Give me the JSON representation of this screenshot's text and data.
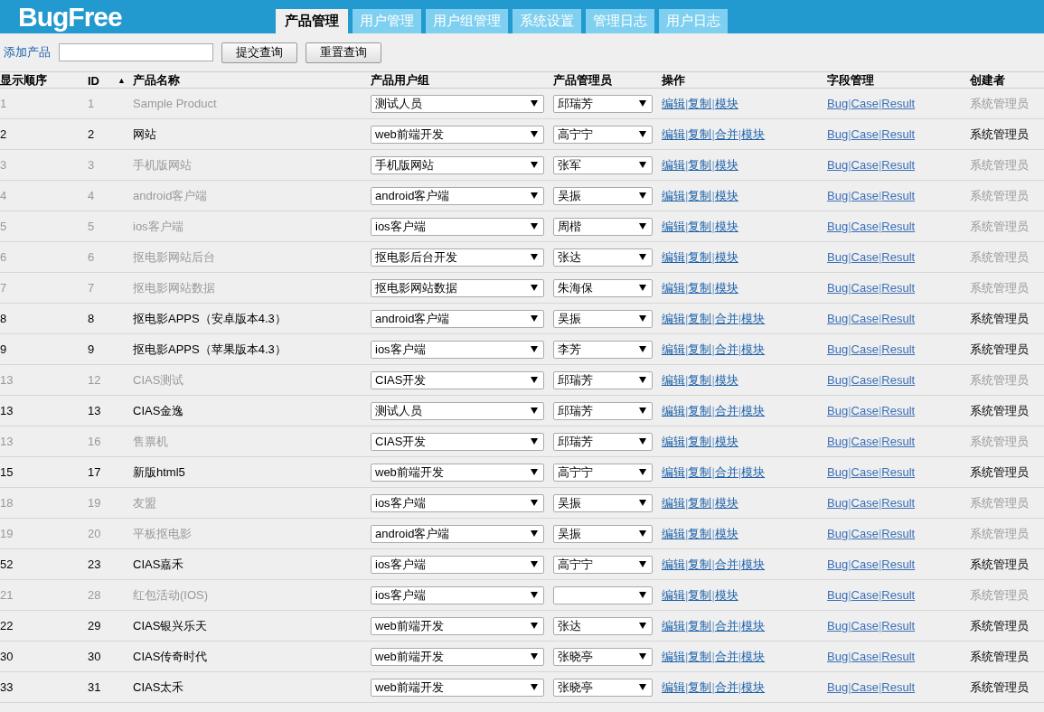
{
  "header": {
    "logo": "BugFree",
    "tabs": [
      {
        "label": "产品管理",
        "selected": true
      },
      {
        "label": "用户管理",
        "selected": false
      },
      {
        "label": "用户组管理",
        "selected": false
      },
      {
        "label": "系统设置",
        "selected": false
      },
      {
        "label": "管理日志",
        "selected": false
      },
      {
        "label": "用户日志",
        "selected": false
      }
    ]
  },
  "toolbar": {
    "add_link": "添加产品",
    "buttons": [
      "提交查询",
      "重置查询"
    ]
  },
  "separator": "|",
  "table": {
    "columns": [
      {
        "label": "显示顺序"
      },
      {
        "label": "ID",
        "sort_indicator": "▲"
      },
      {
        "label": "产品名称"
      },
      {
        "label": "产品用户组"
      },
      {
        "label": "产品管理员"
      },
      {
        "label": "操作"
      },
      {
        "label": "字段管理"
      },
      {
        "label": "创建者"
      }
    ],
    "rows": [
      {
        "order": "1",
        "id": "1",
        "name": "Sample Product",
        "group": "测试人员",
        "manager": "邱瑞芳",
        "actions": [
          "编辑",
          "复制",
          "模块"
        ],
        "fields": [
          "Bug",
          "Case",
          "Result"
        ],
        "creator": "系统管理员",
        "disabled": true
      },
      {
        "order": "2",
        "id": "2",
        "name": "网站",
        "group": "web前端开发",
        "manager": "高宁宁",
        "actions": [
          "编辑",
          "复制",
          "合并",
          "模块"
        ],
        "fields": [
          "Bug",
          "Case",
          "Result"
        ],
        "creator": "系统管理员",
        "disabled": false
      },
      {
        "order": "3",
        "id": "3",
        "name": "手机版网站",
        "group": "手机版网站",
        "manager": "张军",
        "actions": [
          "编辑",
          "复制",
          "模块"
        ],
        "fields": [
          "Bug",
          "Case",
          "Result"
        ],
        "creator": "系统管理员",
        "disabled": true
      },
      {
        "order": "4",
        "id": "4",
        "name": "android客户端",
        "group": "android客户端",
        "manager": "吴振",
        "actions": [
          "编辑",
          "复制",
          "模块"
        ],
        "fields": [
          "Bug",
          "Case",
          "Result"
        ],
        "creator": "系统管理员",
        "disabled": true
      },
      {
        "order": "5",
        "id": "5",
        "name": "ios客户端",
        "group": "ios客户端",
        "manager": "周楷",
        "actions": [
          "编辑",
          "复制",
          "模块"
        ],
        "fields": [
          "Bug",
          "Case",
          "Result"
        ],
        "creator": "系统管理员",
        "disabled": true
      },
      {
        "order": "6",
        "id": "6",
        "name": "抠电影网站后台",
        "group": "抠电影后台开发",
        "manager": "张达",
        "actions": [
          "编辑",
          "复制",
          "模块"
        ],
        "fields": [
          "Bug",
          "Case",
          "Result"
        ],
        "creator": "系统管理员",
        "disabled": true
      },
      {
        "order": "7",
        "id": "7",
        "name": "抠电影网站数据",
        "group": "抠电影网站数据",
        "manager": "朱海保",
        "actions": [
          "编辑",
          "复制",
          "模块"
        ],
        "fields": [
          "Bug",
          "Case",
          "Result"
        ],
        "creator": "系统管理员",
        "disabled": true
      },
      {
        "order": "8",
        "id": "8",
        "name": "抠电影APPS（安卓版本4.3）",
        "group": "android客户端",
        "manager": "吴振",
        "actions": [
          "编辑",
          "复制",
          "合并",
          "模块"
        ],
        "fields": [
          "Bug",
          "Case",
          "Result"
        ],
        "creator": "系统管理员",
        "disabled": false
      },
      {
        "order": "9",
        "id": "9",
        "name": "抠电影APPS（苹果版本4.3）",
        "group": "ios客户端",
        "manager": "李芳",
        "actions": [
          "编辑",
          "复制",
          "合并",
          "模块"
        ],
        "fields": [
          "Bug",
          "Case",
          "Result"
        ],
        "creator": "系统管理员",
        "disabled": false
      },
      {
        "order": "13",
        "id": "12",
        "name": "CIAS测试",
        "group": "CIAS开发",
        "manager": "邱瑞芳",
        "actions": [
          "编辑",
          "复制",
          "模块"
        ],
        "fields": [
          "Bug",
          "Case",
          "Result"
        ],
        "creator": "系统管理员",
        "disabled": true
      },
      {
        "order": "13",
        "id": "13",
        "name": "CIAS金逸",
        "group": "测试人员",
        "manager": "邱瑞芳",
        "actions": [
          "编辑",
          "复制",
          "合并",
          "模块"
        ],
        "fields": [
          "Bug",
          "Case",
          "Result"
        ],
        "creator": "系统管理员",
        "disabled": false
      },
      {
        "order": "13",
        "id": "16",
        "name": "售票机",
        "group": "CIAS开发",
        "manager": "邱瑞芳",
        "actions": [
          "编辑",
          "复制",
          "模块"
        ],
        "fields": [
          "Bug",
          "Case",
          "Result"
        ],
        "creator": "系统管理员",
        "disabled": true
      },
      {
        "order": "15",
        "id": "17",
        "name": "新版html5",
        "group": "web前端开发",
        "manager": "高宁宁",
        "actions": [
          "编辑",
          "复制",
          "合并",
          "模块"
        ],
        "fields": [
          "Bug",
          "Case",
          "Result"
        ],
        "creator": "系统管理员",
        "disabled": false
      },
      {
        "order": "18",
        "id": "19",
        "name": "友盟",
        "group": "ios客户端",
        "manager": "吴振",
        "actions": [
          "编辑",
          "复制",
          "模块"
        ],
        "fields": [
          "Bug",
          "Case",
          "Result"
        ],
        "creator": "系统管理员",
        "disabled": true
      },
      {
        "order": "19",
        "id": "20",
        "name": "平板抠电影",
        "group": "android客户端",
        "manager": "吴振",
        "actions": [
          "编辑",
          "复制",
          "模块"
        ],
        "fields": [
          "Bug",
          "Case",
          "Result"
        ],
        "creator": "系统管理员",
        "disabled": true
      },
      {
        "order": "52",
        "id": "23",
        "name": "CIAS嘉禾",
        "group": "ios客户端",
        "manager": "高宁宁",
        "actions": [
          "编辑",
          "复制",
          "合并",
          "模块"
        ],
        "fields": [
          "Bug",
          "Case",
          "Result"
        ],
        "creator": "系统管理员",
        "disabled": false
      },
      {
        "order": "21",
        "id": "28",
        "name": "红包活动(IOS)",
        "group": "ios客户端",
        "manager": "",
        "actions": [
          "编辑",
          "复制",
          "模块"
        ],
        "fields": [
          "Bug",
          "Case",
          "Result"
        ],
        "creator": "系统管理员",
        "disabled": true
      },
      {
        "order": "22",
        "id": "29",
        "name": "CIAS银兴乐天",
        "group": "web前端开发",
        "manager": "张达",
        "actions": [
          "编辑",
          "复制",
          "合并",
          "模块"
        ],
        "fields": [
          "Bug",
          "Case",
          "Result"
        ],
        "creator": "系统管理员",
        "disabled": false
      },
      {
        "order": "30",
        "id": "30",
        "name": "CIAS传奇时代",
        "group": "web前端开发",
        "manager": "张晓亭",
        "actions": [
          "编辑",
          "复制",
          "合并",
          "模块"
        ],
        "fields": [
          "Bug",
          "Case",
          "Result"
        ],
        "creator": "系统管理员",
        "disabled": false
      },
      {
        "order": "33",
        "id": "31",
        "name": "CIAS太禾",
        "group": "web前端开发",
        "manager": "张晓亭",
        "actions": [
          "编辑",
          "复制",
          "合并",
          "模块"
        ],
        "fields": [
          "Bug",
          "Case",
          "Result"
        ],
        "creator": "系统管理员",
        "disabled": false
      }
    ]
  }
}
